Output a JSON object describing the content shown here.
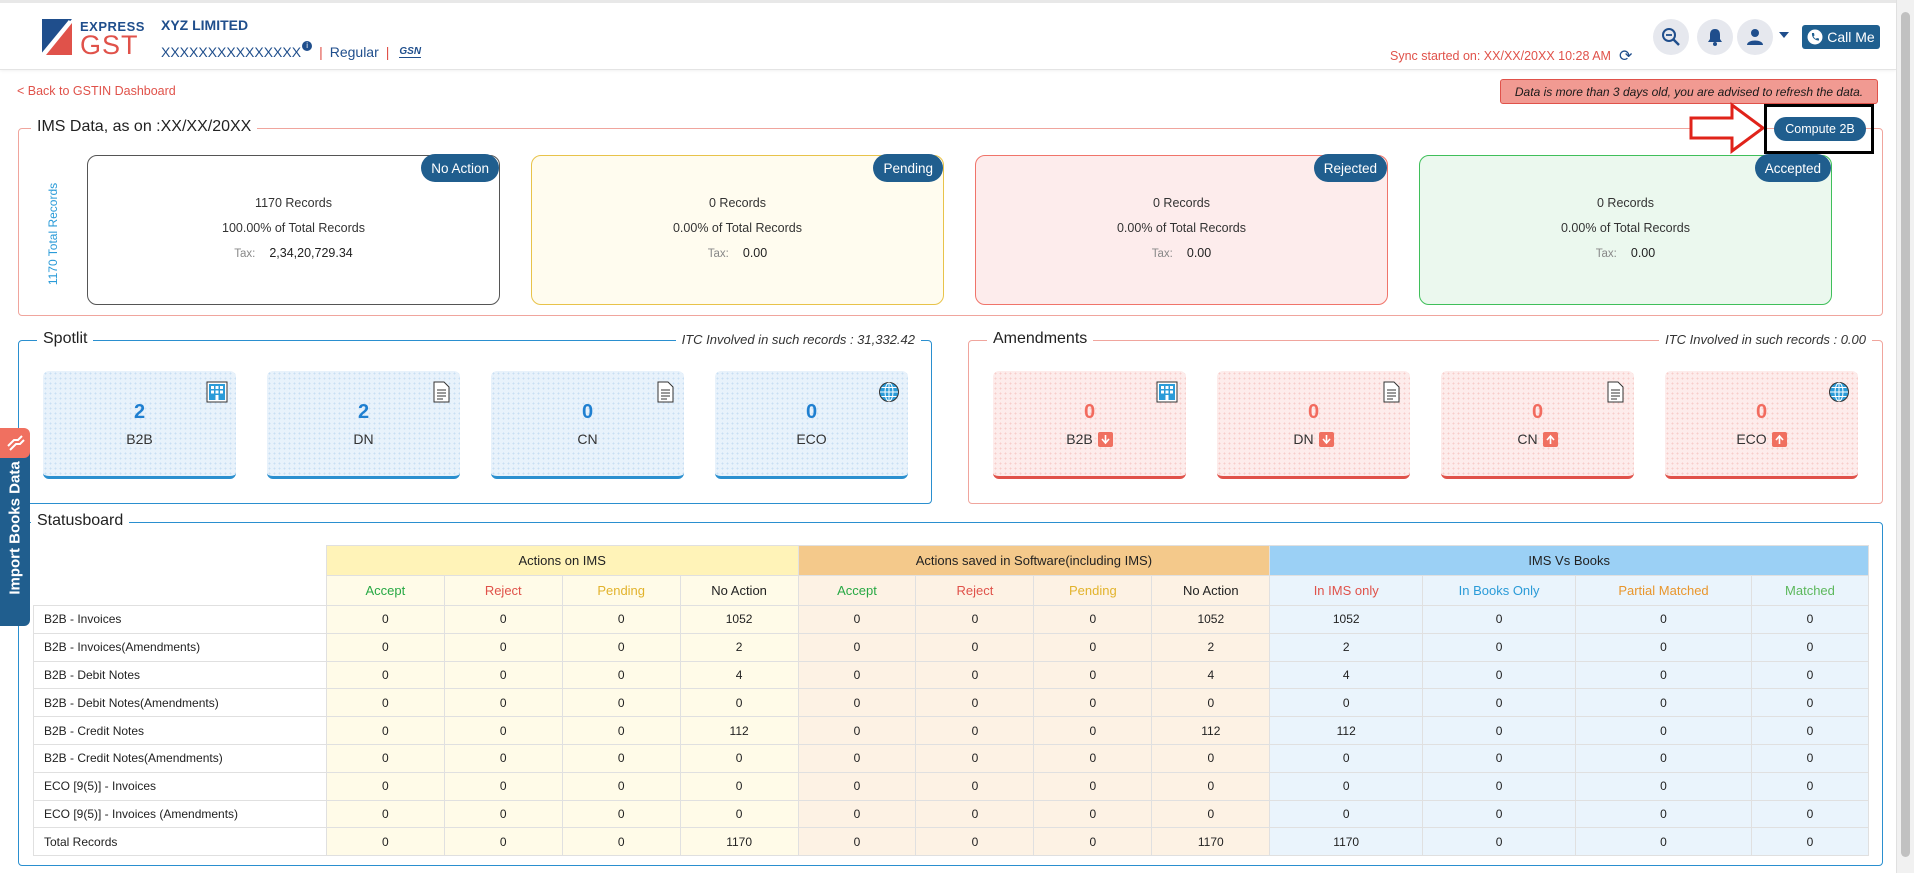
{
  "header": {
    "logo_express": "EXPRESS",
    "logo_gst": "GST",
    "company": "XYZ LIMITED",
    "gstin": "XXXXXXXXXXXXXXX",
    "info_glyph": "i",
    "reg_type": "Regular",
    "separator": "|",
    "gsn_label": "GSN",
    "sync_text": "Sync started on: XX/XX/20XX 10:28 AM",
    "call_me": "Call Me",
    "icons": [
      "search-zoom-icon",
      "bell-icon",
      "user-icon",
      "phone-icon",
      "refresh-icon"
    ]
  },
  "nav": {
    "back_link": "< Back to GSTIN Dashboard"
  },
  "alert": {
    "text": "Data is more than 3 days old, you are advised to refresh the data."
  },
  "ims": {
    "legend": "IMS Data, as on :XX/XX/20XX",
    "total_records": "1170 Total Records",
    "compute_label": "Compute 2B",
    "tax_label": "Tax:",
    "cards": [
      {
        "badge": "No Action",
        "records": "1170 Records",
        "percent": "100.00% of Total Records",
        "tax": "2,34,20,729.34",
        "border": "#555555",
        "bg": "#ffffff"
      },
      {
        "badge": "Pending",
        "records": "0 Records",
        "percent": "0.00% of Total Records",
        "tax": "0.00",
        "border": "#e8c34a",
        "bg": "#fffcef"
      },
      {
        "badge": "Rejected",
        "records": "0 Records",
        "percent": "0.00% of Total Records",
        "tax": "0.00",
        "border": "#f0746a",
        "bg": "#fdecec"
      },
      {
        "badge": "Accepted",
        "records": "0 Records",
        "percent": "0.00% of Total Records",
        "tax": "0.00",
        "border": "#3fbf5a",
        "bg": "#ebf8ee"
      }
    ]
  },
  "spotlit": {
    "legend": "Spotlit",
    "itc": "ITC Involved in such records : 31,332.42",
    "tiles": [
      {
        "value": "2",
        "label": "B2B",
        "icon": "building-icon"
      },
      {
        "value": "2",
        "label": "DN",
        "icon": "document-icon"
      },
      {
        "value": "0",
        "label": "CN",
        "icon": "document-icon"
      },
      {
        "value": "0",
        "label": "ECO",
        "icon": "globe-icon"
      }
    ]
  },
  "amendments": {
    "legend": "Amendments",
    "itc": "ITC Involved in such records : 0.00",
    "tiles": [
      {
        "value": "0",
        "label": "B2B",
        "icon": "building-icon",
        "dir": "down"
      },
      {
        "value": "0",
        "label": "DN",
        "icon": "document-icon",
        "dir": "down"
      },
      {
        "value": "0",
        "label": "CN",
        "icon": "document-icon",
        "dir": "up"
      },
      {
        "value": "0",
        "label": "ECO",
        "icon": "globe-icon",
        "dir": "up"
      }
    ]
  },
  "statusboard": {
    "legend": "Statusboard",
    "groups": [
      "Actions on IMS",
      "Actions saved in Software(including IMS)",
      "IMS Vs Books"
    ],
    "subcols": [
      "Accept",
      "Reject",
      "Pending",
      "No Action",
      "Accept",
      "Reject",
      "Pending",
      "No Action",
      "In IMS only",
      "In Books Only",
      "Partial Matched",
      "Matched"
    ],
    "rows": [
      {
        "label": "B2B - Invoices",
        "values": [
          "0",
          "0",
          "0",
          "1052",
          "0",
          "0",
          "0",
          "1052",
          "1052",
          "0",
          "0",
          "0"
        ]
      },
      {
        "label": "B2B - Invoices(Amendments)",
        "values": [
          "0",
          "0",
          "0",
          "2",
          "0",
          "0",
          "0",
          "2",
          "2",
          "0",
          "0",
          "0"
        ]
      },
      {
        "label": "B2B - Debit Notes",
        "values": [
          "0",
          "0",
          "0",
          "4",
          "0",
          "0",
          "0",
          "4",
          "4",
          "0",
          "0",
          "0"
        ]
      },
      {
        "label": "B2B - Debit Notes(Amendments)",
        "values": [
          "0",
          "0",
          "0",
          "0",
          "0",
          "0",
          "0",
          "0",
          "0",
          "0",
          "0",
          "0"
        ]
      },
      {
        "label": "B2B - Credit Notes",
        "values": [
          "0",
          "0",
          "0",
          "112",
          "0",
          "0",
          "0",
          "112",
          "112",
          "0",
          "0",
          "0"
        ]
      },
      {
        "label": "B2B - Credit Notes(Amendments)",
        "values": [
          "0",
          "0",
          "0",
          "0",
          "0",
          "0",
          "0",
          "0",
          "0",
          "0",
          "0",
          "0"
        ]
      },
      {
        "label": "ECO [9(5)] - Invoices",
        "values": [
          "0",
          "0",
          "0",
          "0",
          "0",
          "0",
          "0",
          "0",
          "0",
          "0",
          "0",
          "0"
        ]
      },
      {
        "label": "ECO [9(5)] - Invoices (Amendments)",
        "values": [
          "0",
          "0",
          "0",
          "0",
          "0",
          "0",
          "0",
          "0",
          "0",
          "0",
          "0",
          "0"
        ]
      },
      {
        "label": "Total Records",
        "values": [
          "0",
          "0",
          "0",
          "1170",
          "0",
          "0",
          "0",
          "1170",
          "1170",
          "0",
          "0",
          "0"
        ]
      }
    ]
  },
  "import_tab": {
    "label": "Import Books Data"
  },
  "colors": {
    "primary": "#205e8e",
    "accent_red": "#e0524a",
    "accent_blue": "#2a8fcf"
  }
}
